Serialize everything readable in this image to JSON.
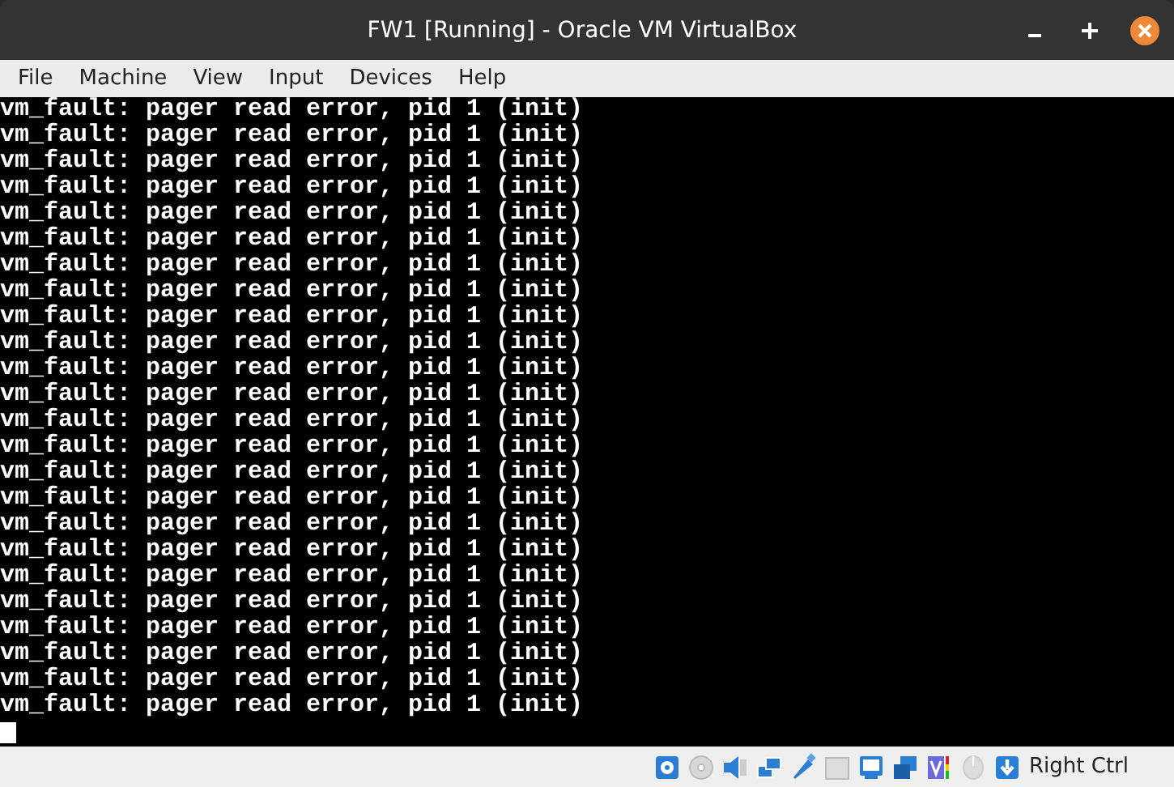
{
  "window": {
    "title": "FW1 [Running] - Oracle VM VirtualBox"
  },
  "menu": [
    "File",
    "Machine",
    "View",
    "Input",
    "Devices",
    "Help"
  ],
  "console": {
    "lines": [
      "vm_fault: pager read error, pid 1 (init)",
      "vm_fault: pager read error, pid 1 (init)",
      "vm_fault: pager read error, pid 1 (init)",
      "vm_fault: pager read error, pid 1 (init)",
      "vm_fault: pager read error, pid 1 (init)",
      "vm_fault: pager read error, pid 1 (init)",
      "vm_fault: pager read error, pid 1 (init)",
      "vm_fault: pager read error, pid 1 (init)",
      "vm_fault: pager read error, pid 1 (init)",
      "vm_fault: pager read error, pid 1 (init)",
      "vm_fault: pager read error, pid 1 (init)",
      "vm_fault: pager read error, pid 1 (init)",
      "vm_fault: pager read error, pid 1 (init)",
      "vm_fault: pager read error, pid 1 (init)",
      "vm_fault: pager read error, pid 1 (init)",
      "vm_fault: pager read error, pid 1 (init)",
      "vm_fault: pager read error, pid 1 (init)",
      "vm_fault: pager read error, pid 1 (init)",
      "vm_fault: pager read error, pid 1 (init)",
      "vm_fault: pager read error, pid 1 (init)",
      "vm_fault: pager read error, pid 1 (init)",
      "vm_fault: pager read error, pid 1 (init)",
      "vm_fault: pager read error, pid 1 (init)",
      "vm_fault: pager read error, pid 1 (init)"
    ],
    "cursor": true
  },
  "status_bar": {
    "host_key": "Right Ctrl"
  }
}
